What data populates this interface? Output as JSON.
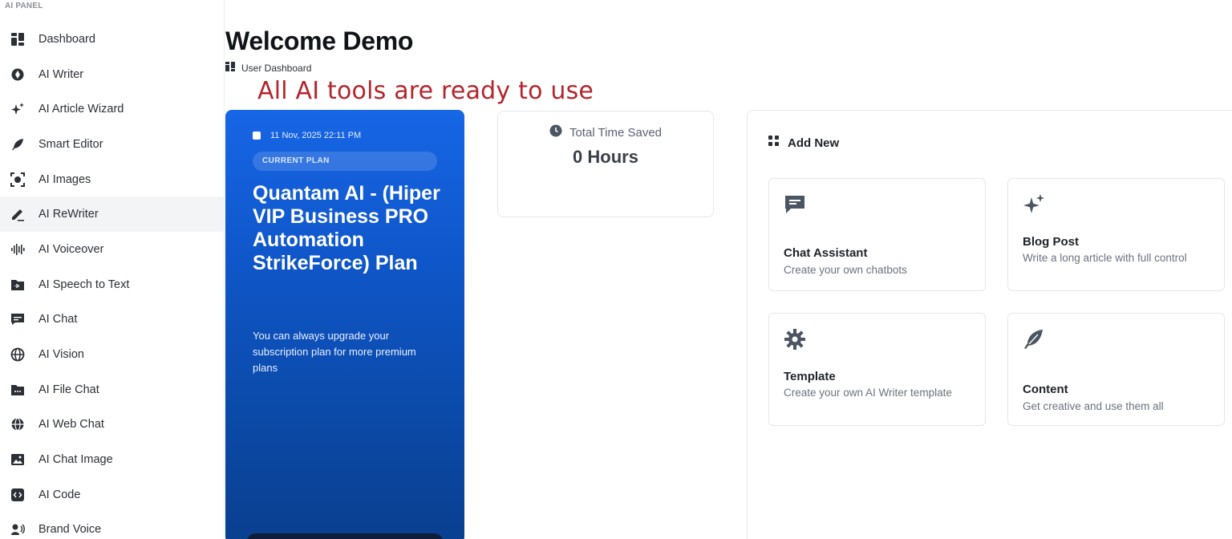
{
  "sidebar": {
    "panel_label": "AI PANEL",
    "items": [
      {
        "label": "Dashboard",
        "icon": "grid-icon"
      },
      {
        "label": "AI Writer",
        "icon": "pen-nib-icon"
      },
      {
        "label": "AI Article Wizard",
        "icon": "sparkles-icon"
      },
      {
        "label": "Smart Editor",
        "icon": "feather-icon"
      },
      {
        "label": "AI Images",
        "icon": "image-scan-icon"
      },
      {
        "label": "AI ReWriter",
        "icon": "pencil-icon"
      },
      {
        "label": "AI Voiceover",
        "icon": "waveform-icon"
      },
      {
        "label": "AI Speech to Text",
        "icon": "folder-audio-icon"
      },
      {
        "label": "AI Chat",
        "icon": "chat-icon"
      },
      {
        "label": "AI Vision",
        "icon": "globe-icon"
      },
      {
        "label": "AI File Chat",
        "icon": "folder-icon"
      },
      {
        "label": "AI Web Chat",
        "icon": "web-icon"
      },
      {
        "label": "AI Chat Image",
        "icon": "photo-icon"
      },
      {
        "label": "AI Code",
        "icon": "code-icon"
      },
      {
        "label": "Brand Voice",
        "icon": "voice-icon"
      }
    ],
    "active_index": 5
  },
  "header": {
    "title": "Welcome Demo",
    "breadcrumb": "User Dashboard"
  },
  "overlay_caption": "All AI tools are ready to use",
  "plan": {
    "date": "11 Nov, 2025 22:11 PM",
    "badge": "CURRENT PLAN",
    "name": "Quantam AI - (Hiper VIP Business PRO Automation StrikeForce) Plan",
    "description": "You can always upgrade your subscription plan for more premium plans"
  },
  "time_saved": {
    "label": "Total Time Saved",
    "value": "0 Hours"
  },
  "add_new": {
    "title": "Add New",
    "tiles": [
      {
        "title": "Chat Assistant",
        "desc": "Create your own chatbots",
        "icon": "chat-bubble-icon"
      },
      {
        "title": "Blog Post",
        "desc": "Write a long article with full control",
        "icon": "sparkles-icon"
      },
      {
        "title": "Template",
        "desc": "Create your own AI Writer template",
        "icon": "gear-icon"
      },
      {
        "title": "Content",
        "desc": "Get creative and use them all",
        "icon": "feather-icon"
      }
    ]
  },
  "colors": {
    "plan_gradient_top": "#1766e6",
    "plan_gradient_bottom": "#0a3f8f",
    "caption": "#b3262d",
    "active_nav_bg": "#f3f4f6"
  }
}
